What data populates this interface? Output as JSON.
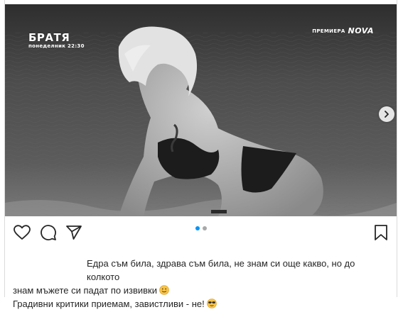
{
  "media": {
    "show_title": "БРАТЯ",
    "show_schedule": "понеделник 22:30",
    "premiere_label": "ПРЕМИЕРА",
    "channel_brand": "NOVA",
    "carousel_count": 2,
    "carousel_active_index": 0
  },
  "actions": {
    "like": "heart-icon",
    "comment": "comment-icon",
    "share": "send-icon",
    "save": "bookmark-icon"
  },
  "caption": {
    "line1": "Едра съм била, здрава съм била, не знам си още какво, но до колкото",
    "line2": "знам мъжете си падат по извивки",
    "line2_emoji": "smiling-face-emoji",
    "line3": "Градивни критики приемам, завистливи - не!",
    "line3_emoji": "sunglasses-face-emoji"
  },
  "colors": {
    "accent": "#0095f6",
    "text": "#262626",
    "border": "#dbdbdb"
  }
}
